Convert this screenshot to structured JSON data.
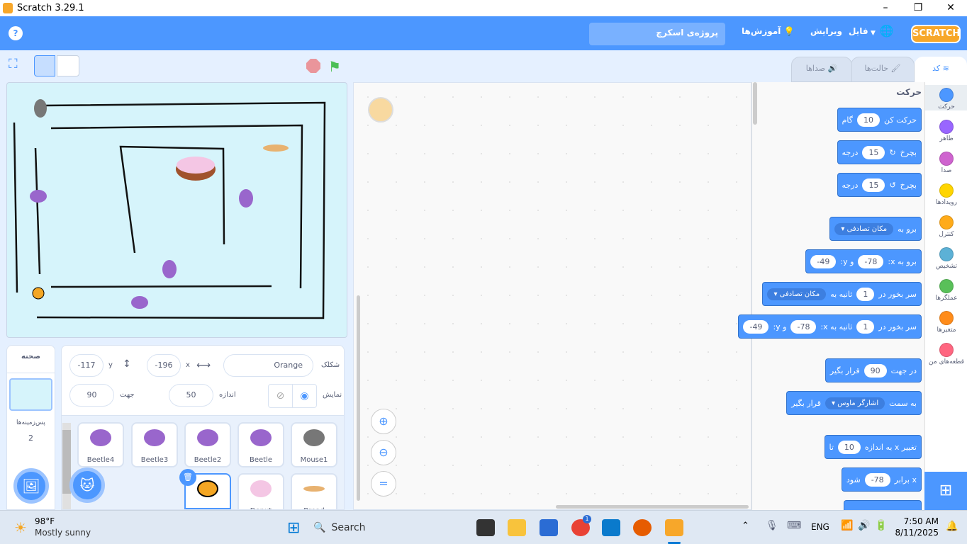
{
  "window": {
    "title": "Scratch 3.29.1",
    "minimize": "–",
    "maximize": "❐",
    "close": "✕"
  },
  "menu": {
    "logo": "SCRATCH",
    "language_icon": "globe-icon",
    "file": "فایل",
    "edit": "ویرایش",
    "tutorials": "آموزش‌ها",
    "project_title": "پروژه‌ی اسکرچ",
    "help": "?"
  },
  "tabs": {
    "code": "کد",
    "costumes": "حالت‌ها",
    "sounds": "صداها"
  },
  "palette": {
    "section_title": "حرکت",
    "categories": [
      {
        "label": "حرکت",
        "color": "#4c97ff"
      },
      {
        "label": "ظاهر",
        "color": "#9966ff"
      },
      {
        "label": "صدا",
        "color": "#cf63cf"
      },
      {
        "label": "رویدادها",
        "color": "#ffd500"
      },
      {
        "label": "کنترل",
        "color": "#ffab19"
      },
      {
        "label": "تشخیص",
        "color": "#5cb1d6"
      },
      {
        "label": "عملگرها",
        "color": "#59c059"
      },
      {
        "label": "متغیرها",
        "color": "#ff8c1a"
      },
      {
        "label": "قطعه‌های من",
        "color": "#ff6680"
      }
    ],
    "blocks": {
      "move": {
        "a": "حرکت کن",
        "v": "10",
        "b": "گام"
      },
      "turn_right": {
        "a": "بچرخ",
        "icon": "↻",
        "v": "15",
        "b": "درجه"
      },
      "turn_left": {
        "a": "بچرخ",
        "icon": "↺",
        "v": "15",
        "b": "درجه"
      },
      "goto": {
        "a": "برو به",
        "dd": "مکان تصادفی"
      },
      "goto_xy": {
        "a": "برو به x:",
        "x": "-78",
        "b": "و y:",
        "y": "-49"
      },
      "glide": {
        "a": "سر بخور در",
        "v": "1",
        "b": "ثانیه به",
        "dd": "مکان تصادفی"
      },
      "glide_xy": {
        "a": "سر بخور در",
        "v": "1",
        "b": "ثانیه به x:",
        "x": "-78",
        "c": "و y:",
        "y": "-49"
      },
      "point_dir": {
        "a": "در جهت",
        "v": "90",
        "b": "قرار بگیر"
      },
      "point_towards": {
        "a": "به سمت",
        "dd": "اشارگر ماوس",
        "b": "قرار بگیر"
      },
      "change_x": {
        "a": "تغییر x به اندازه",
        "v": "10",
        "b": "تا"
      },
      "set_x": {
        "a": "x برابر",
        "v": "-78",
        "b": "شود"
      }
    }
  },
  "sprite_info": {
    "sprite_label": "شکلک",
    "name": "Orange",
    "x_label": "x",
    "x": "-196",
    "y_label": "y",
    "y": "-117",
    "show_label": "نمایش",
    "size_label": "اندازه",
    "size": "50",
    "direction_label": "جهت",
    "direction": "90"
  },
  "stage_panel": {
    "title": "صحنه",
    "backdrops_label": "پس‌زمینه‌ها",
    "backdrops_count": "2"
  },
  "sprites": [
    "Beetle4",
    "Beetle3",
    "Beetle2",
    "Beetle",
    "Mouse1",
    "Orange",
    "Donut",
    "Bread"
  ],
  "taskbar": {
    "temp": "98°F",
    "weather": "Mostly sunny",
    "search": "Search",
    "lang": "ENG",
    "time": "7:50 AM",
    "date": "8/11/2025",
    "badge": "1"
  }
}
